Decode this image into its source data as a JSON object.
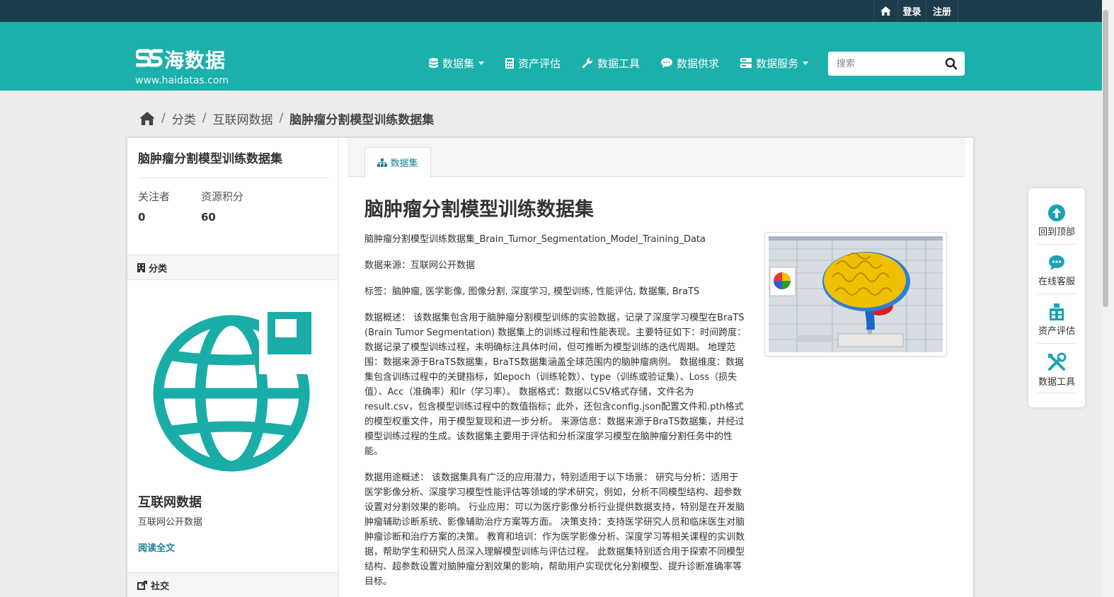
{
  "topbar": {
    "login": "登录",
    "register": "注册"
  },
  "header": {
    "logo_text": "海数据",
    "logo_url": "www.haidatas.com",
    "nav": [
      {
        "label": "数据集",
        "icon": "database-icon",
        "dropdown": true
      },
      {
        "label": "资产评估",
        "icon": "calculator-icon",
        "dropdown": false
      },
      {
        "label": "数据工具",
        "icon": "wrench-icon",
        "dropdown": false
      },
      {
        "label": "数据供求",
        "icon": "comment-icon",
        "dropdown": false
      },
      {
        "label": "数据服务",
        "icon": "server-icon",
        "dropdown": true
      }
    ],
    "search_placeholder": "搜索"
  },
  "breadcrumb": {
    "items": [
      "分类",
      "互联网数据"
    ],
    "current": "脑肿瘤分割模型训练数据集"
  },
  "sidebar": {
    "title": "脑肿瘤分割模型训练数据集",
    "stats": [
      {
        "label": "关注者",
        "value": "0"
      },
      {
        "label": "资源积分",
        "value": "60"
      }
    ],
    "category_heading": "分类",
    "category_name": "互联网数据",
    "category_desc": "互联网公开数据",
    "read_more": "阅读全文",
    "social_heading": "社交"
  },
  "content": {
    "tab_label": "数据集",
    "title": "脑肿瘤分割模型训练数据集",
    "paragraphs": [
      "脑肿瘤分割模型训练数据集_Brain_Tumor_Segmentation_Model_Training_Data",
      "数据来源：互联网公开数据",
      "标签：脑肿瘤, 医学影像, 图像分割, 深度学习, 模型训练, 性能评估, 数据集, BraTS",
      "数据概述： 该数据集包含用于脑肿瘤分割模型训练的实验数据，记录了深度学习模型在BraTS (Brain Tumor Segmentation) 数据集上的训练过程和性能表现。主要特征如下：时间跨度：数据记录了模型训练过程，未明确标注具体时间，但可推断为模型训练的迭代周期。 地理范围：数据来源于BraTS数据集，BraTS数据集涵盖全球范围内的脑肿瘤病例。 数据维度：数据集包含训练过程中的关键指标，如epoch（训练轮数）、type（训练或验证集）、Loss（损失值）、Acc（准确率）和lr（学习率）。 数据格式：数据以CSV格式存储，文件名为result.csv，包含模型训练过程中的数值指标；此外，还包含config.json配置文件和.pth格式的模型权重文件，用于模型复现和进一步分析。 来源信息：数据来源于BraTS数据集，并经过模型训练过程的生成。该数据集主要用于评估和分析深度学习模型在脑肿瘤分割任务中的性能。",
      "数据用途概述： 该数据集具有广泛的应用潜力，特别适用于以下场景： 研究与分析：适用于医学影像分析、深度学习模型性能评估等领域的学术研究，例如，分析不同模型结构、超参数设置对分割效果的影响。 行业应用：可以为医疗影像分析行业提供数据支持，特别是在开发脑肿瘤辅助诊断系统、影像辅助治疗方案等方面。 决策支持：支持医学研究人员和临床医生对脑肿瘤诊断和治疗方案的决策。 教育和培训：作为医学影像分析、深度学习等相关课程的实训数据，帮助学生和研究人员深入理解模型训练与评估过程。 此数据集特别适合用于探索不同模型结构、超参数设置对脑肿瘤分割效果的影响，帮助用户实现优化分割模型、提升诊断准确率等目标。"
    ]
  },
  "floatbar": [
    {
      "label": "回到顶部",
      "icon": "arrow-up-icon"
    },
    {
      "label": "在线客服",
      "icon": "chat-icon"
    },
    {
      "label": "资产评估",
      "icon": "assessment-icon"
    },
    {
      "label": "数据工具",
      "icon": "tools-icon"
    }
  ],
  "colors": {
    "topbar": "#1d3b4b",
    "header": "#1bb0ac",
    "link": "#1a7d9a"
  }
}
